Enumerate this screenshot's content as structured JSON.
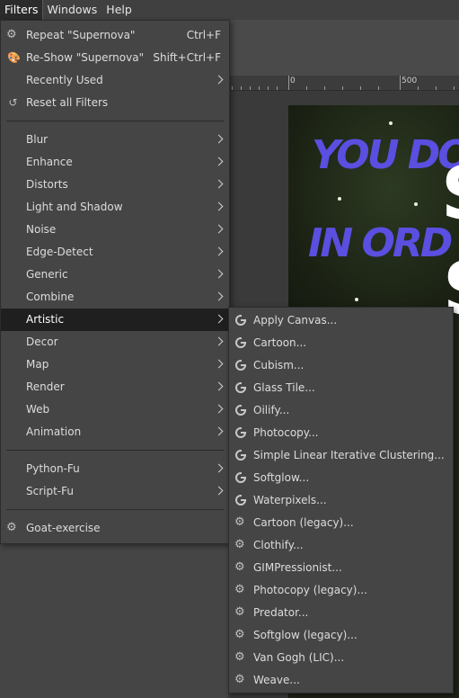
{
  "menubar": {
    "items": [
      "Filters",
      "Windows",
      "Help"
    ]
  },
  "ruler": {
    "labels": [
      "0",
      "500"
    ]
  },
  "image_text": {
    "line1": "YOU DO",
    "line2": "IN ORD"
  },
  "filters_menu": {
    "top_items": [
      {
        "label": "Repeat \"Supernova\"",
        "accel": "Ctrl+F",
        "icon": "repeat-filter-icon"
      },
      {
        "label": "Re-Show \"Supernova\"",
        "accel": "Shift+Ctrl+F",
        "icon": "reshow-filter-icon"
      },
      {
        "label": "Recently Used",
        "submenu": true
      },
      {
        "label": "Reset all Filters",
        "icon": "reset-icon"
      }
    ],
    "categories": [
      "Blur",
      "Enhance",
      "Distorts",
      "Light and Shadow",
      "Noise",
      "Edge-Detect",
      "Generic",
      "Combine",
      "Artistic",
      "Decor",
      "Map",
      "Render",
      "Web",
      "Animation"
    ],
    "highlighted": "Artistic",
    "scripting": [
      "Python-Fu",
      "Script-Fu"
    ],
    "extra": {
      "label": "Goat-exercise",
      "icon": "gear-icon"
    }
  },
  "artistic_submenu": {
    "gegl_items": [
      "Apply Canvas...",
      "Cartoon...",
      "Cubism...",
      "Glass Tile...",
      "Oilify...",
      "Photocopy...",
      "Simple Linear Iterative Clustering...",
      "Softglow...",
      "Waterpixels..."
    ],
    "legacy_items": [
      "Cartoon (legacy)...",
      "Clothify...",
      "GIMPressionist...",
      "Photocopy (legacy)...",
      "Predator...",
      "Softglow (legacy)...",
      "Van Gogh (LIC)...",
      "Weave..."
    ]
  }
}
